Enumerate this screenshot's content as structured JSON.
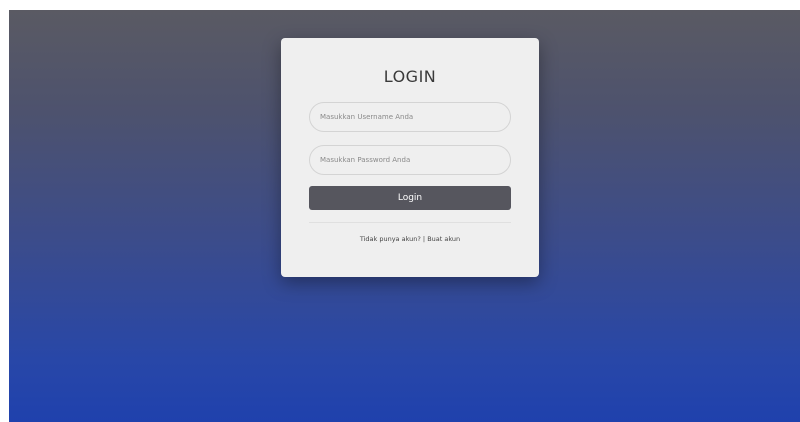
{
  "login_card": {
    "title": "LOGIN",
    "username": {
      "value": "",
      "placeholder": "Masukkan Username Anda"
    },
    "password": {
      "value": "",
      "placeholder": "Masukkan Password Anda"
    },
    "submit_label": "Login",
    "footer": {
      "question": "Tidak punya akun?",
      "separator": "|",
      "link_label": "Buat akun"
    }
  },
  "colors": {
    "background_top": "#5a5a63",
    "background_bottom": "#1f41ad",
    "card": "#efefef",
    "button": "#56565e"
  }
}
